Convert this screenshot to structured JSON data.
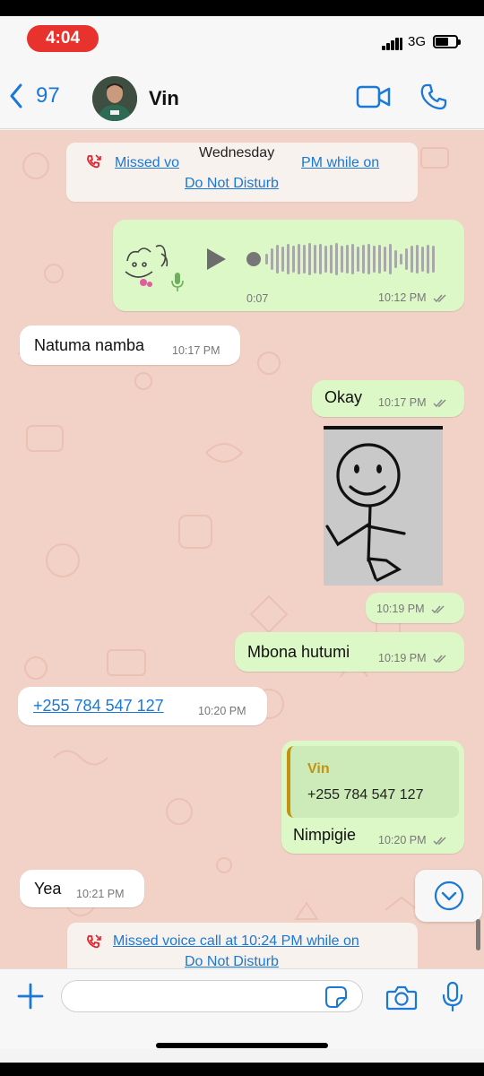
{
  "status_bar": {
    "time": "4:04",
    "network": "3G"
  },
  "header": {
    "back_count": "97",
    "contact_name": "Vin"
  },
  "chat": {
    "system_top": {
      "prefix": "Missed vo",
      "date_chip": "Wednesday",
      "suffix": " PM while on",
      "line2": "Do Not Disturb"
    },
    "voice_message": {
      "duration": "0:07",
      "time": "10:12 PM"
    },
    "messages": [
      {
        "text": "Natuma namba",
        "time": "10:17 PM"
      },
      {
        "text": "Okay",
        "time": "10:17 PM"
      },
      {
        "text": "",
        "time": "10:19 PM"
      },
      {
        "text": "Mbona hutumi",
        "time": "10:19 PM"
      },
      {
        "text": "+255 784 547 127",
        "time": "10:20 PM"
      },
      {
        "text": "Nimpigie",
        "time": "10:20 PM"
      },
      {
        "text": "Yea",
        "time": "10:21 PM"
      }
    ],
    "reply_quote": {
      "name": "Vin",
      "text": "+255 784 547 127"
    },
    "system_bottom": {
      "line1": "Missed voice call at 10:24 PM while on",
      "line2": "Do Not Disturb"
    }
  },
  "input": {
    "value": "",
    "placeholder": ""
  },
  "colors": {
    "accent": "#1a78d6",
    "outgoing_bubble": "#dcf8c6",
    "incoming_bubble": "#ffffff",
    "chat_background": "#f2d2c6",
    "time_pill": "#e8322e",
    "missed_call": "#e0242e",
    "quote_bar": "#c4920f"
  },
  "icons": {
    "back": "chevron-left-icon",
    "video": "video-camera-icon",
    "phone": "phone-icon",
    "missed_call": "missed-call-icon",
    "play": "play-icon",
    "mic": "microphone-icon",
    "read": "double-check-icon",
    "scroll": "chevron-down-icon",
    "plus": "plus-icon",
    "sticker": "sticker-icon",
    "camera": "camera-icon"
  }
}
